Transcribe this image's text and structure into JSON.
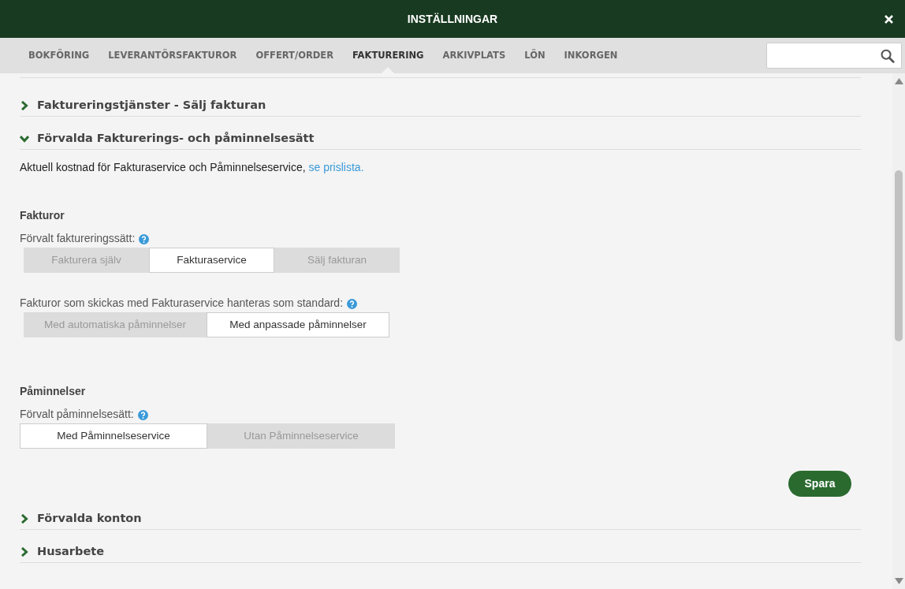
{
  "window": {
    "title": "INSTÄLLNINGAR"
  },
  "tabs": [
    {
      "label": "BOKFÖRING",
      "selected": false
    },
    {
      "label": "LEVERANTÖRSFAKTUROR",
      "selected": false
    },
    {
      "label": "OFFERT/ORDER",
      "selected": false
    },
    {
      "label": "FAKTURERING",
      "selected": true
    },
    {
      "label": "ARKIVPLATS",
      "selected": false
    },
    {
      "label": "LÖN",
      "selected": false
    },
    {
      "label": "INKORGEN",
      "selected": false
    }
  ],
  "sections": [
    {
      "title": "Faktureringstjänster - Sälj fakturan",
      "expanded": false
    },
    {
      "title": "Förvalda Fakturerings- och påminnelsesätt",
      "expanded": true,
      "intro": {
        "text": "Aktuell kostnad för Fakturaservice och Påminnelseservice,",
        "link": "se prislista."
      },
      "groups": [
        {
          "heading": "Fakturor",
          "fields": [
            {
              "label": "Förvalt faktureringssätt:",
              "options": [
                {
                  "label": "Fakturera själv",
                  "selected": false
                },
                {
                  "label": "Fakturaservice",
                  "selected": true
                },
                {
                  "label": "Sälj fakturan",
                  "selected": false
                }
              ]
            },
            {
              "label": "Fakturor som skickas med Fakturaservice hanteras som standard:",
              "options": [
                {
                  "label": "Med automatiska påminnelser",
                  "selected": false
                },
                {
                  "label": "Med anpassade påminnelser",
                  "selected": true
                }
              ]
            }
          ]
        },
        {
          "heading": "Påminnelser",
          "fields": [
            {
              "label": "Förvalt påminnelsesätt:",
              "options": [
                {
                  "label": "Med Påminnelseservice",
                  "selected": true
                },
                {
                  "label": "Utan Påminnelseservice",
                  "selected": false
                }
              ]
            }
          ]
        }
      ],
      "save_button": "Spara"
    },
    {
      "title": "Förvalda konton",
      "expanded": false
    },
    {
      "title": "Husarbete",
      "expanded": false
    }
  ]
}
